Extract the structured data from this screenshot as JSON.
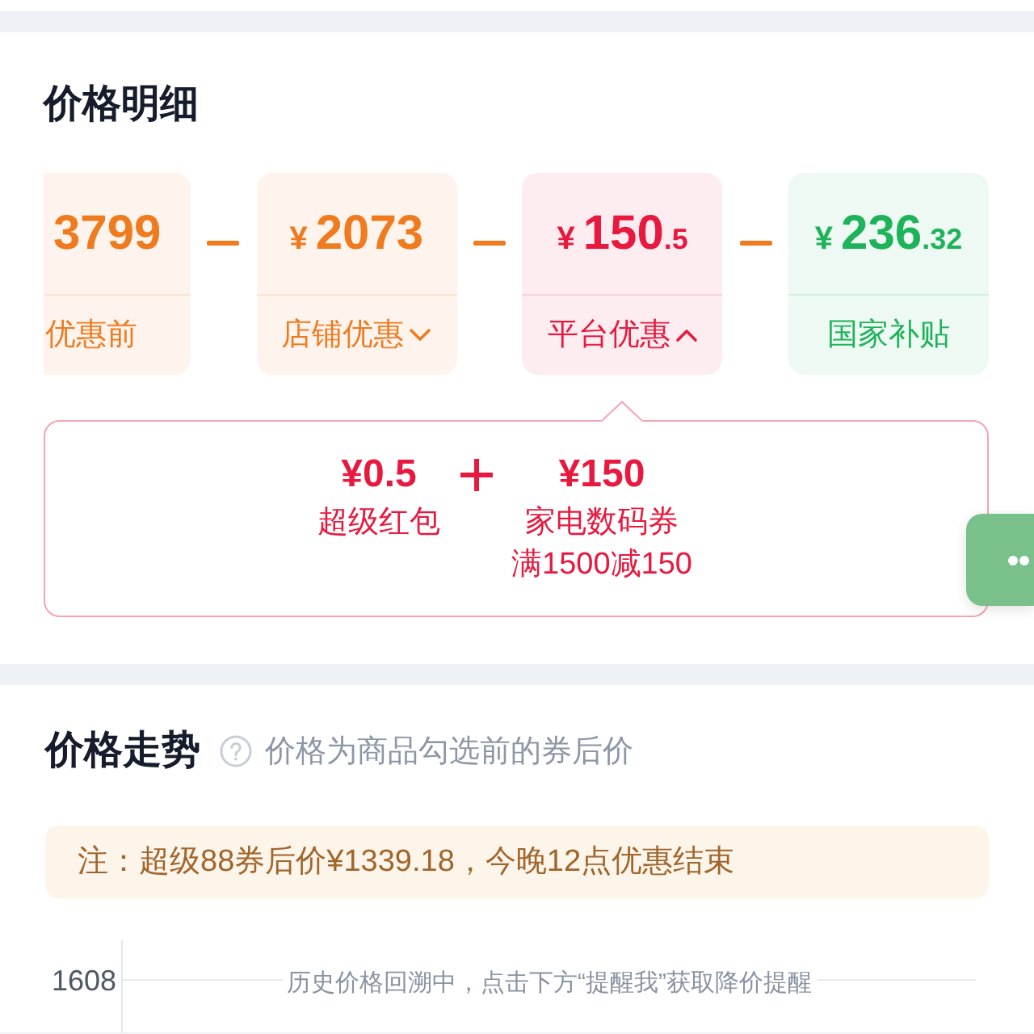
{
  "price_detail": {
    "title": "价格明细",
    "price_cards": [
      {
        "kind": "cut",
        "amount": "3799",
        "label": "优惠前",
        "color": "#f07a1e"
      },
      {
        "kind": "expandable",
        "currency": "¥",
        "amount": "2073",
        "label": "店铺优惠",
        "color": "#f07a1e",
        "expanded": false
      },
      {
        "kind": "expandable",
        "currency": "¥",
        "amount": "150",
        "decimal": ".5",
        "label": "平台优惠",
        "color": "#e8193f",
        "expanded": true
      },
      {
        "kind": "plain",
        "currency": "¥",
        "amount": "236",
        "decimal": ".32",
        "label": "国家补贴",
        "color": "#1eb35a"
      }
    ],
    "discount_details": [
      {
        "amount": "¥0.5",
        "name": "超级红包"
      },
      {
        "amount": "¥150",
        "name": "家电数码券",
        "condition": "满1500减150"
      }
    ]
  },
  "price_trend": {
    "title": "价格走势",
    "subtitle": "价格为商品勾选前的券后价",
    "note": "注：超级88券后价¥1339.18，今晚12点优惠结束",
    "chart": {
      "y_tick": "1608",
      "message": "历史价格回溯中，点击下方“提醒我”获取降价提醒"
    }
  }
}
